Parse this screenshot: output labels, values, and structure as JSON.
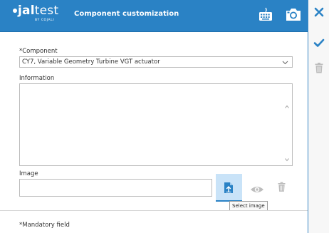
{
  "header": {
    "logo_text_bold": "jal",
    "logo_text_light": "test",
    "logo_sub": "BY COJALI",
    "title": "Component customization",
    "keyboard_icon": "keyboard-icon",
    "camera_icon": "camera-icon",
    "background_color": "#2a82c5"
  },
  "sidebar": {
    "close_icon": "close-icon",
    "confirm_icon": "checkmark-icon",
    "delete_icon": "trash-icon",
    "confirm_color": "#2a82c5"
  },
  "form": {
    "component_label": "*Component",
    "component_value": "CY7, Variable Geometry Turbine VGT actuator",
    "information_label": "Information",
    "information_value": "",
    "image_label": "Image",
    "image_value": "",
    "select_image_tooltip": "Select image",
    "mandatory_note": "*Mandatory field"
  }
}
